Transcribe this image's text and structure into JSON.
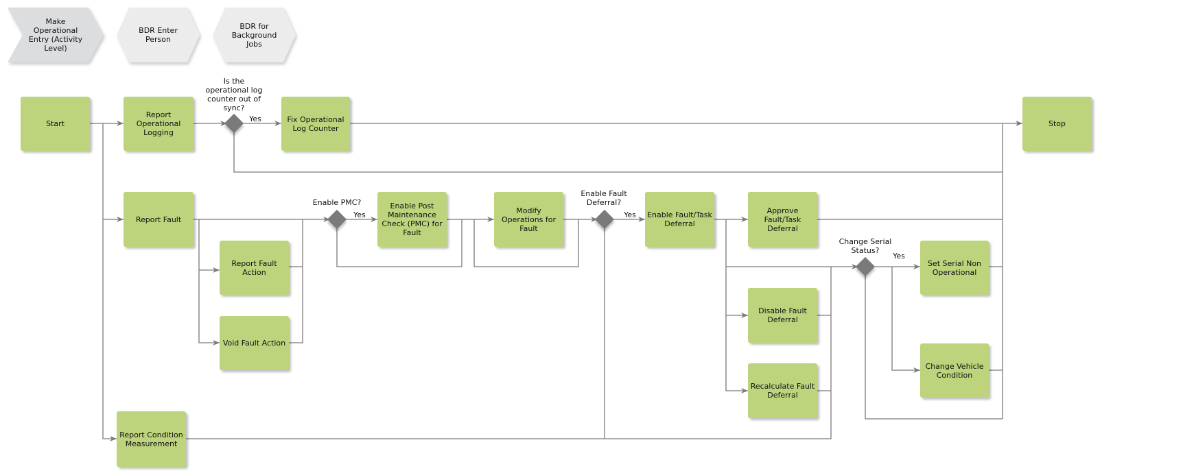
{
  "colors": {
    "task": "#bdd37c",
    "connector": "#7a7a7a",
    "gateway": "#7a7a7a",
    "process_primary": "#dcdddf",
    "process_secondary": "#ececec"
  },
  "processes": [
    {
      "label": "Make Operational Entry (Activity Level)"
    },
    {
      "label": "BDR Enter Person"
    },
    {
      "label": "BDR for Background Jobs"
    }
  ],
  "tasks": {
    "start": "Start",
    "report_operational_logging": "Report Operational Logging",
    "fix_operational_log_counter": "Fix Operational Log Counter",
    "stop": "Stop",
    "report_fault": "Report Fault",
    "report_fault_action": "Report Fault Action",
    "void_fault_action": "Void Fault Action",
    "enable_pmc": "Enable Post Maintenance Check (PMC) for Fault",
    "modify_operations": "Modify Operations for Fault",
    "enable_fault_task_deferral": "Enable Fault/Task Deferral",
    "approve_fault_task_deferral": "Approve Fault/Task Deferral",
    "disable_fault_deferral": "Disable Fault Deferral",
    "recalculate_fault_deferral": "Recalculate Fault Deferral",
    "report_condition_measurement": "Report Condition Measurement",
    "set_serial_non_operational": "Set Serial Non Operational",
    "change_vehicle_condition": "Change Vehicle Condition"
  },
  "gateways": {
    "log_counter_sync": {
      "question": "Is the operational log counter out of sync?",
      "yes": "Yes"
    },
    "enable_pmc": {
      "question": "Enable PMC?",
      "yes": "Yes"
    },
    "enable_fault_deferral": {
      "question": "Enable Fault Deferral?",
      "yes": "Yes"
    },
    "change_serial_status": {
      "question": "Change Serial Status?",
      "yes": "Yes"
    }
  }
}
